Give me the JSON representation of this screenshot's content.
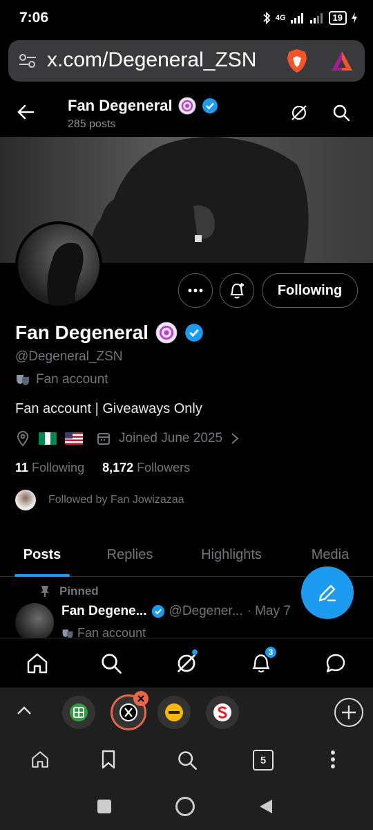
{
  "status_bar": {
    "time": "7:06",
    "battery": "19",
    "network": "4G"
  },
  "browser": {
    "url": "x.com/Degeneral_ZSN"
  },
  "header": {
    "title": "Fan Degeneral",
    "subtitle": "285 posts"
  },
  "profile": {
    "name": "Fan Degeneral",
    "handle": "@Degeneral_ZSN",
    "category": "Fan account",
    "bio": "Fan account | Giveaways Only",
    "joined": "Joined June 2025",
    "following_count": "11",
    "following_label": "Following",
    "followers_count": "8,172",
    "followers_label": "Followers",
    "followed_by": "Followed by Fan Jowizazaa",
    "follow_button": "Following"
  },
  "tabs": [
    {
      "label": "Posts",
      "active": true
    },
    {
      "label": "Replies",
      "active": false
    },
    {
      "label": "Highlights",
      "active": false
    },
    {
      "label": "Media",
      "active": false
    }
  ],
  "post": {
    "pinned_label": "Pinned",
    "name": "Fan Degene...",
    "handle": "@Degener...",
    "date": "· May 7",
    "line": "Fan account"
  },
  "nav": {
    "notifications_badge": "3"
  },
  "browser_nav": {
    "tab_count": "5"
  },
  "colors": {
    "accent": "#1d9bf0",
    "background": "#000000",
    "muted": "#71767b"
  }
}
